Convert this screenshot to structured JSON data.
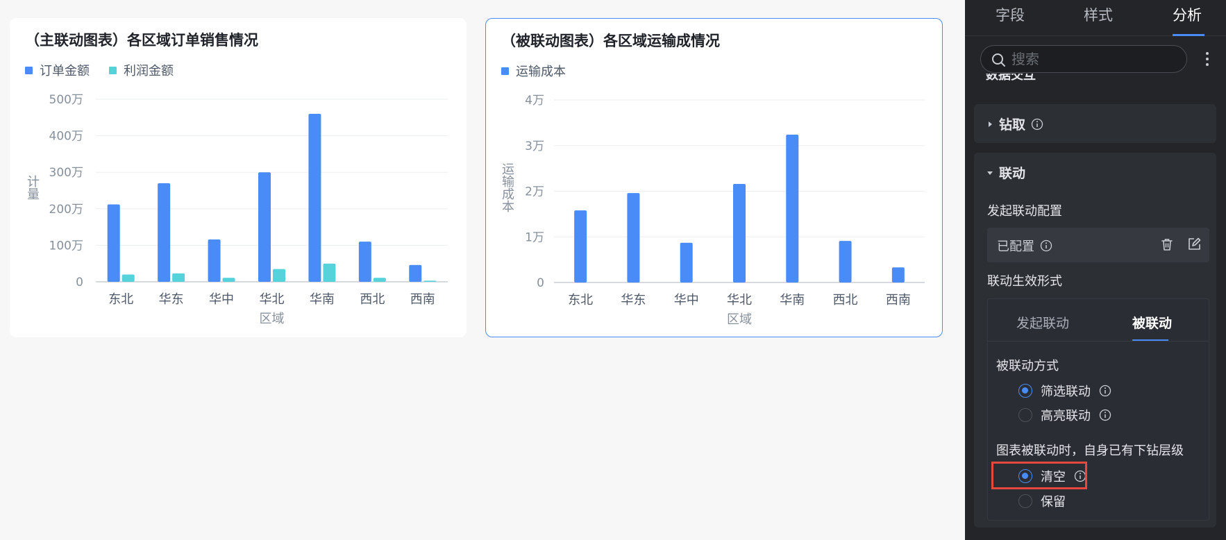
{
  "charts": {
    "main": {
      "title": "（主联动图表）各区域订单销售情况",
      "legend": [
        {
          "label": "订单金额",
          "color": "#4a8cf7"
        },
        {
          "label": "利润金额",
          "color": "#56d2db"
        }
      ]
    },
    "linked": {
      "title": "（被联动图表）各区域运输成情况",
      "legend": [
        {
          "label": "运输成本",
          "color": "#4a8cf7"
        }
      ]
    }
  },
  "chart_data": [
    {
      "type": "bar",
      "title": "（主联动图表）各区域订单销售情况",
      "categories": [
        "东北",
        "华东",
        "华中",
        "华北",
        "华南",
        "西北",
        "西南"
      ],
      "series": [
        {
          "name": "订单金额",
          "values": [
            212,
            270,
            116,
            300,
            460,
            110,
            46
          ],
          "color": "#4a8cf7"
        },
        {
          "name": "利润金额",
          "values": [
            20,
            23,
            11,
            35,
            50,
            11,
            3
          ],
          "color": "#56d2db"
        }
      ],
      "yticks": [
        "0",
        "100万",
        "200万",
        "300万",
        "400万",
        "500万"
      ],
      "ylim": [
        0,
        500
      ],
      "xlabel": "区域",
      "ylabel": "计量",
      "grid": true,
      "legend_position": "top-left"
    },
    {
      "type": "bar",
      "title": "（被联动图表）各区域运输成情况",
      "categories": [
        "东北",
        "华东",
        "华中",
        "华北",
        "华南",
        "西北",
        "西南"
      ],
      "series": [
        {
          "name": "运输成本",
          "values": [
            1.58,
            1.96,
            0.87,
            2.16,
            3.24,
            0.91,
            0.33
          ],
          "color": "#4a8cf7"
        }
      ],
      "yticks": [
        "0",
        "1万",
        "2万",
        "3万",
        "4万"
      ],
      "ylim": [
        0,
        4
      ],
      "xlabel": "区域",
      "ylabel": "运输成本",
      "grid": true,
      "legend_position": "top-left"
    }
  ],
  "panel": {
    "tabs": [
      "字段",
      "样式",
      "分析"
    ],
    "active_tab": "分析",
    "search_placeholder": "搜索",
    "partial_header": "数据交互",
    "drill": {
      "label": "钻取"
    },
    "linkage": {
      "label": "联动",
      "initiate_config_label": "发起联动配置",
      "config_status": "已配置",
      "effect_form_label": "联动生效形式",
      "mode_tabs": [
        "发起联动",
        "被联动"
      ],
      "active_mode": "被联动",
      "method_label": "被联动方式",
      "methods": [
        {
          "label": "筛选联动",
          "selected": true
        },
        {
          "label": "高亮联动",
          "selected": false
        }
      ],
      "drill_level_label": "图表被联动时，自身已有下钻层级",
      "drill_options": [
        {
          "label": "清空",
          "selected": true
        },
        {
          "label": "保留",
          "selected": false
        }
      ]
    }
  }
}
